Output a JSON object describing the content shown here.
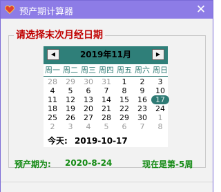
{
  "window": {
    "title": "预产期计算器",
    "close_label": "✕",
    "icon": "heart-icon"
  },
  "group": {
    "title": "请选择末次月经日期"
  },
  "calendar": {
    "month_label": "2019年11月",
    "prev_label": "◀",
    "next_label": "▶",
    "weekdays": [
      "周一",
      "周二",
      "周三",
      "周四",
      "周五",
      "周六",
      "周日"
    ],
    "weeks": [
      [
        {
          "d": "28",
          "o": true
        },
        {
          "d": "29",
          "o": true
        },
        {
          "d": "30",
          "o": true
        },
        {
          "d": "31",
          "o": true
        },
        {
          "d": "1"
        },
        {
          "d": "2"
        },
        {
          "d": "3"
        }
      ],
      [
        {
          "d": "4"
        },
        {
          "d": "5"
        },
        {
          "d": "6"
        },
        {
          "d": "7"
        },
        {
          "d": "8"
        },
        {
          "d": "9"
        },
        {
          "d": "10"
        }
      ],
      [
        {
          "d": "11"
        },
        {
          "d": "12"
        },
        {
          "d": "13"
        },
        {
          "d": "14"
        },
        {
          "d": "15"
        },
        {
          "d": "16"
        },
        {
          "d": "17",
          "s": true
        }
      ],
      [
        {
          "d": "18"
        },
        {
          "d": "19"
        },
        {
          "d": "20"
        },
        {
          "d": "21"
        },
        {
          "d": "22"
        },
        {
          "d": "23"
        },
        {
          "d": "24"
        }
      ],
      [
        {
          "d": "25"
        },
        {
          "d": "26"
        },
        {
          "d": "27"
        },
        {
          "d": "28"
        },
        {
          "d": "29"
        },
        {
          "d": "30"
        },
        {
          "d": "1",
          "o": true
        }
      ],
      [
        {
          "d": "2",
          "o": true
        },
        {
          "d": "3",
          "o": true
        },
        {
          "d": "4",
          "o": true
        },
        {
          "d": "5",
          "o": true
        },
        {
          "d": "6",
          "o": true
        },
        {
          "d": "7",
          "o": true
        },
        {
          "d": "8",
          "o": true
        }
      ]
    ],
    "today_label": "今天:",
    "today_value": "2019-10-17"
  },
  "result": {
    "due_label": "预产期为:",
    "due_value": "2020-8-24",
    "week_text": "现在是第-5周"
  },
  "colors": {
    "title_bar": "#8d7ce6",
    "calendar_header": "#2f7f79",
    "heading": "#c00000",
    "result": "#138a13"
  }
}
